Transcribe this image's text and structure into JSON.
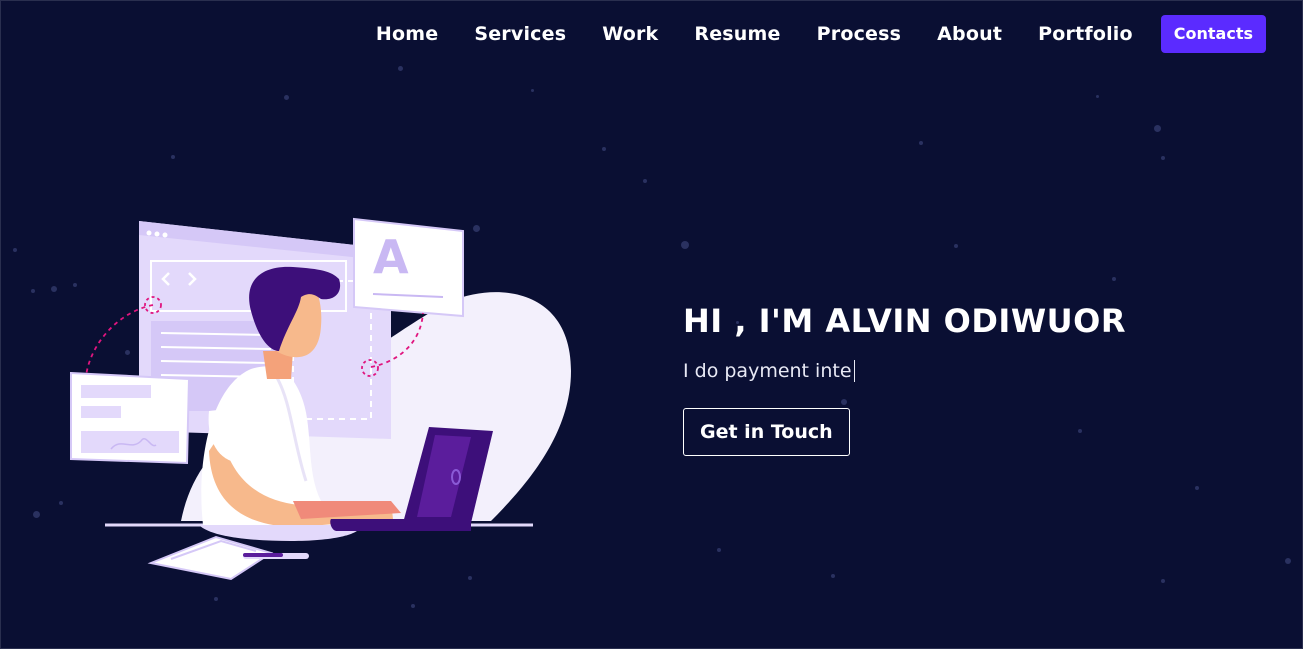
{
  "nav": {
    "links": [
      "Home",
      "Services",
      "Work",
      "Resume",
      "Process",
      "About",
      "Portfolio"
    ],
    "cta_label": "Contacts"
  },
  "hero": {
    "title": "HI , I'M ALVIN ODIWUOR",
    "subtitle": "I do payment inte",
    "button_label": "Get in Touch",
    "illustration_letter": "A"
  },
  "colors": {
    "background": "#0a0f33",
    "accent": "#5b2bff",
    "illustration_purple": "#3d0f7a",
    "illustration_lavender": "#e3d9fb"
  }
}
